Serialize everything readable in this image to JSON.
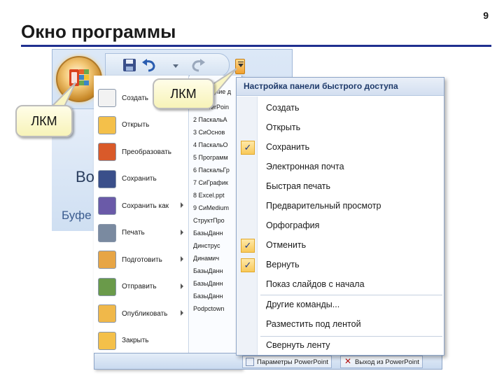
{
  "slide": {
    "title": "Окно программы",
    "page_number": "9"
  },
  "callouts": {
    "left": "ЛКМ",
    "top": "ЛКМ"
  },
  "ribbon": {
    "group_label": "Буфе",
    "partial_label": "Во"
  },
  "office_menu": {
    "items": [
      {
        "label": "Создать",
        "icon": "new-document-icon"
      },
      {
        "label": "Открыть",
        "icon": "open-folder-icon"
      },
      {
        "label": "Преобразовать",
        "icon": "convert-icon"
      },
      {
        "label": "Сохранить",
        "icon": "save-icon"
      },
      {
        "label": "Сохранить как",
        "icon": "save-as-icon",
        "submenu": true
      },
      {
        "label": "Печать",
        "icon": "print-icon",
        "submenu": true
      },
      {
        "label": "Подготовить",
        "icon": "prepare-icon",
        "submenu": true
      },
      {
        "label": "Отправить",
        "icon": "send-icon",
        "submenu": true
      },
      {
        "label": "Опубликовать",
        "icon": "publish-icon",
        "submenu": true
      },
      {
        "label": "Закрыть",
        "icon": "close-folder-icon"
      }
    ],
    "recent_heading": "Последние д",
    "recent": [
      "1 PowerPoin",
      "2 ПаскальА",
      "3 СиОснов",
      "4 ПаскальО",
      "5 Программ",
      "6 ПаскальГр",
      "7 СиГрафик",
      "8 Excel.ppt",
      "9 СиMedium",
      "СтруктПро",
      "БазыДанн",
      "Динструс",
      "Динамич",
      "БазыДанн",
      "БазыДанн",
      "БазыДанн",
      "Podpctown"
    ],
    "bottom_buttons": {
      "options": "Параметры PowerPoint",
      "exit": "Выход из PowerPoint"
    }
  },
  "qat_menu": {
    "header": "Настройка панели быстрого доступа",
    "items": [
      {
        "label": "Создать",
        "checked": false
      },
      {
        "label": "Открыть",
        "checked": false
      },
      {
        "label": "Сохранить",
        "checked": true
      },
      {
        "label": "Электронная почта",
        "checked": false
      },
      {
        "label": "Быстрая печать",
        "checked": false
      },
      {
        "label": "Предварительный просмотр",
        "checked": false
      },
      {
        "label": "Орфография",
        "checked": false
      },
      {
        "label": "Отменить",
        "checked": true
      },
      {
        "label": "Вернуть",
        "checked": true
      },
      {
        "label": "Показ слайдов с начала",
        "checked": false
      }
    ],
    "more_commands": "Другие команды...",
    "place_below": "Разместить под лентой",
    "minimize": "Свернуть ленту",
    "check_glyph": "✓"
  },
  "colors": {
    "title_rule": "#1f2f8f",
    "check_bg": "#f8c95a",
    "header_text": "#1e3a6a"
  }
}
